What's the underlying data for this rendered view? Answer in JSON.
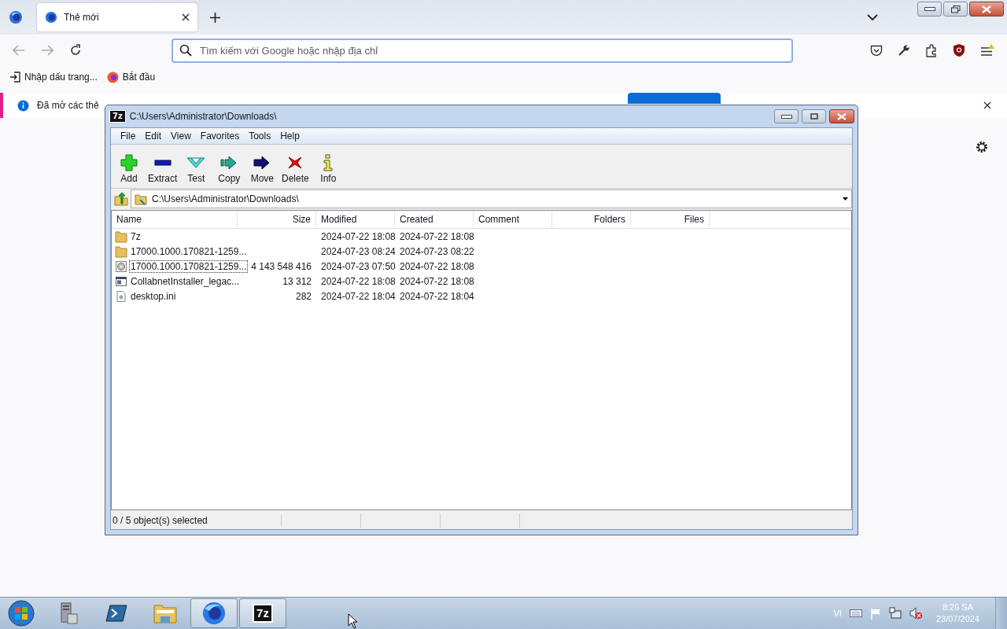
{
  "browser": {
    "tabs": [
      {
        "title": "Thẻ mới",
        "selected": true
      }
    ],
    "address": {
      "placeholder": "Tìm kiếm với Google hoặc nhập địa chỉ"
    },
    "bookmarks": [
      {
        "label": "Nhập dấu trang...",
        "kind": "import"
      },
      {
        "label": "Bắt đầu",
        "kind": "firefox"
      }
    ],
    "notification": {
      "text": "Đã mở các thẻ"
    }
  },
  "archiver": {
    "logo": "7z",
    "title": "C:\\Users\\Administrator\\Downloads\\",
    "menu": [
      "File",
      "Edit",
      "View",
      "Favorites",
      "Tools",
      "Help"
    ],
    "toolbar": [
      {
        "label": "Add",
        "kind": "add"
      },
      {
        "label": "Extract",
        "kind": "extract"
      },
      {
        "label": "Test",
        "kind": "test"
      },
      {
        "label": "Copy",
        "kind": "copy"
      },
      {
        "label": "Move",
        "kind": "move"
      },
      {
        "label": "Delete",
        "kind": "delete"
      },
      {
        "label": "Info",
        "kind": "info"
      }
    ],
    "path": "C:\\Users\\Administrator\\Downloads\\",
    "columns": [
      "Name",
      "Size",
      "Modified",
      "Created",
      "Comment",
      "Folders",
      "Files"
    ],
    "rows": [
      {
        "kind": "folder",
        "name": "7z",
        "modified": "2024-07-22 18:08",
        "created": "2024-07-22 18:08",
        "focused": false
      },
      {
        "kind": "folder",
        "name": "17000.1000.170821-1259...",
        "modified": "2024-07-23 08:24",
        "created": "2024-07-23 08:22",
        "focused": false
      },
      {
        "kind": "disc",
        "name": "17000.1000.170821-1259...",
        "size": "4 143 548 416",
        "modified": "2024-07-23 07:50",
        "created": "2024-07-22 18:08",
        "focused": true
      },
      {
        "kind": "program",
        "name": "CollabnetInstaller_legac...",
        "size": "13 312",
        "modified": "2024-07-22 18:08",
        "created": "2024-07-22 18:08",
        "focused": false
      },
      {
        "kind": "settings",
        "name": "desktop.ini",
        "size": "282",
        "modified": "2024-07-22 18:04",
        "created": "2024-07-22 18:04",
        "focused": false
      }
    ],
    "status": "0 / 5 object(s) selected"
  },
  "taskbar": {
    "apps": [
      {
        "kind": "server",
        "active": false
      },
      {
        "kind": "shell",
        "active": false
      },
      {
        "kind": "explorer",
        "active": false
      },
      {
        "kind": "firefox",
        "active": true
      },
      {
        "kind": "archiver",
        "active": true,
        "label": "7z"
      }
    ],
    "language": "VI",
    "time": "8:26 SA",
    "date": "23/07/2024"
  }
}
